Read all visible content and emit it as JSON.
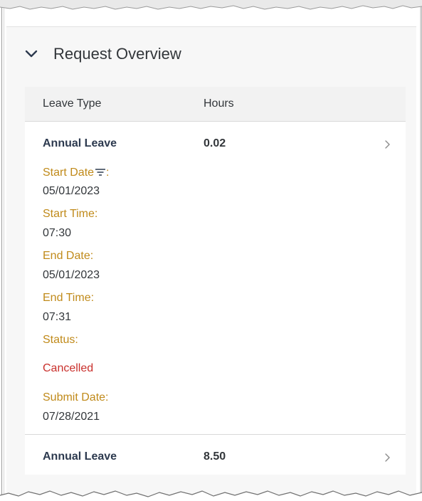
{
  "section": {
    "title": "Request Overview",
    "toggle_icon": "chevron-down-icon"
  },
  "table": {
    "columns": [
      "Leave Type",
      "Hours"
    ],
    "rows": [
      {
        "leave_type": "Annual Leave",
        "hours": "0.02",
        "details": {
          "start_date_label": "Start Date",
          "start_date_label_suffix": ":",
          "start_date_icon": "sort-filter-icon",
          "start_date": "05/01/2023",
          "start_time_label": "Start Time:",
          "start_time": "07:30",
          "end_date_label": "End Date:",
          "end_date": "05/01/2023",
          "end_time_label": "End Time:",
          "end_time": "07:31",
          "status_label": "Status:",
          "status": "Cancelled",
          "submit_date_label": "Submit Date:",
          "submit_date": "07/28/2021"
        }
      },
      {
        "leave_type": "Annual Leave",
        "hours": "8.50"
      }
    ]
  },
  "colors": {
    "label": "#c08a1a",
    "status_cancelled": "#c9302c",
    "title": "#32363a",
    "leave_type": "#2d3a4f"
  }
}
